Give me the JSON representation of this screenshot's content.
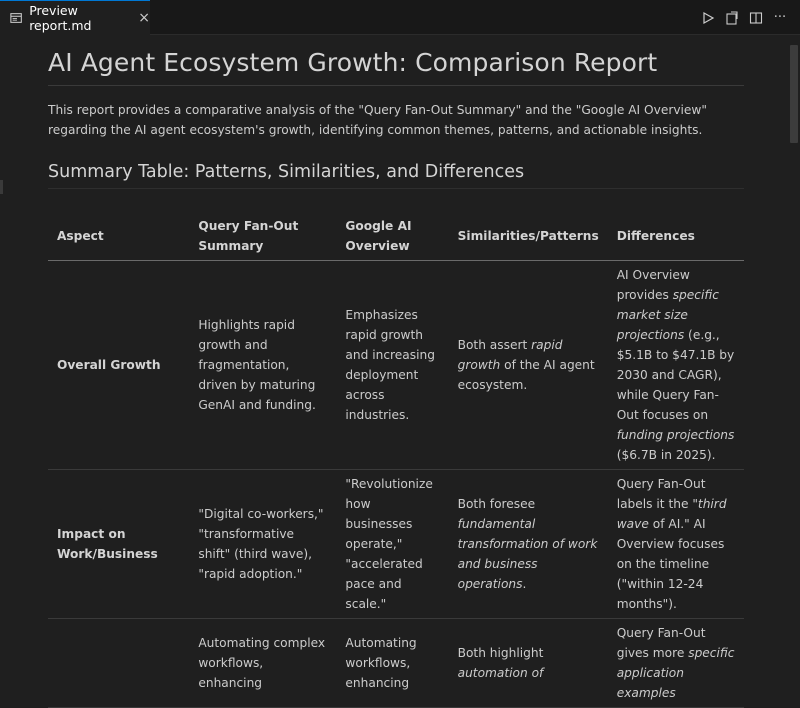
{
  "tab": {
    "label": "Preview report.md",
    "close": "×"
  },
  "document": {
    "title": "AI Agent Ecosystem Growth: Comparison Report",
    "intro": "This report provides a comparative analysis of the \"Query Fan-Out Summary\" and the \"Google AI Overview\" regarding the AI agent ecosystem's growth, identifying common themes, patterns, and actionable insights.",
    "section_title": "Summary Table: Patterns, Similarities, and Differences",
    "table": {
      "headers": {
        "aspect": "Aspect",
        "qfo": "Query Fan-Out Summary",
        "gai": "Google AI Overview",
        "sim": "Similarities/Patterns",
        "diff": "Differences"
      },
      "rows": [
        {
          "aspect": "Overall Growth",
          "qfo": "Highlights rapid growth and fragmentation, driven by maturing GenAI and funding.",
          "gai": "Emphasizes rapid growth and increasing deployment across industries.",
          "sim": {
            "a": "Both assert ",
            "b": "rapid growth",
            "c": " of the AI agent ecosystem."
          },
          "diff": {
            "a": "AI Overview provides ",
            "b": "specific market size projections",
            "c": " (e.g., $5.1B to $47.1B by 2030 and CAGR), while Query Fan-Out focuses on ",
            "d": "funding projections",
            "e": " ($6.7B in 2025)."
          }
        },
        {
          "aspect": "Impact on Work/Business",
          "qfo": "\"Digital co-workers,\" \"transformative shift\" (third wave), \"rapid adoption.\"",
          "gai": "\"Revolutionize how businesses operate,\" \"accelerated pace and scale.\"",
          "sim": {
            "a": "Both foresee ",
            "b": "fundamental transformation of work and business operations",
            "c": "."
          },
          "diff": {
            "a": "Query Fan-Out labels it the \"",
            "b": "third wave",
            "c": " of AI.\" AI Overview focuses on the timeline (\"within 12-24 months\").",
            "d": "",
            "e": ""
          }
        },
        {
          "aspect": "",
          "qfo": "Automating complex workflows, enhancing",
          "gai": "Automating workflows, enhancing",
          "sim": {
            "a": "Both highlight ",
            "b": "automation of",
            "c": ""
          },
          "diff": {
            "a": "Query Fan-Out gives more ",
            "b": "specific application examples",
            "c": "",
            "d": "",
            "e": ""
          }
        }
      ]
    }
  },
  "icons": {
    "run": "run-icon",
    "split": "split-editor-icon",
    "more": "more-actions-icon",
    "more_glyph": "···"
  }
}
